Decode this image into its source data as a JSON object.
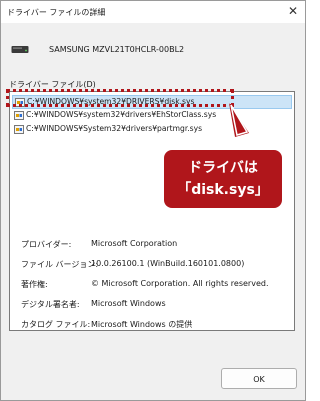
{
  "window": {
    "title": "ドライバー ファイルの詳細",
    "close_glyph": "✕"
  },
  "device": {
    "name": "SAMSUNG MZVL21T0HCLR-00BL2"
  },
  "files": {
    "label": "ドライバー ファイル(D)",
    "items": [
      {
        "path": "C:¥WINDOWS¥system32¥DRIVERS¥disk.sys",
        "selected": true
      },
      {
        "path": "C:¥WINDOWS¥system32¥drivers¥EhStorClass.sys",
        "selected": false
      },
      {
        "path": "C:¥WINDOWS¥System32¥drivers¥partmgr.sys",
        "selected": false
      }
    ]
  },
  "callout": {
    "line1": "ドライバは",
    "line2": "「disk.sys」",
    "color": "#b0161b"
  },
  "properties": {
    "provider_label": "プロバイダー:",
    "provider_value": "Microsoft Corporation",
    "version_label": "ファイル バージョン:",
    "version_value": "10.0.26100.1 (WinBuild.160101.0800)",
    "copyright_label": "著作権:",
    "copyright_value": "© Microsoft Corporation. All rights reserved.",
    "signer_label": "デジタル署名者:",
    "signer_value": "Microsoft Windows",
    "catalog_label": "カタログ ファイル:",
    "catalog_value": "Microsoft Windows の提供"
  },
  "buttons": {
    "ok_label": "OK"
  }
}
